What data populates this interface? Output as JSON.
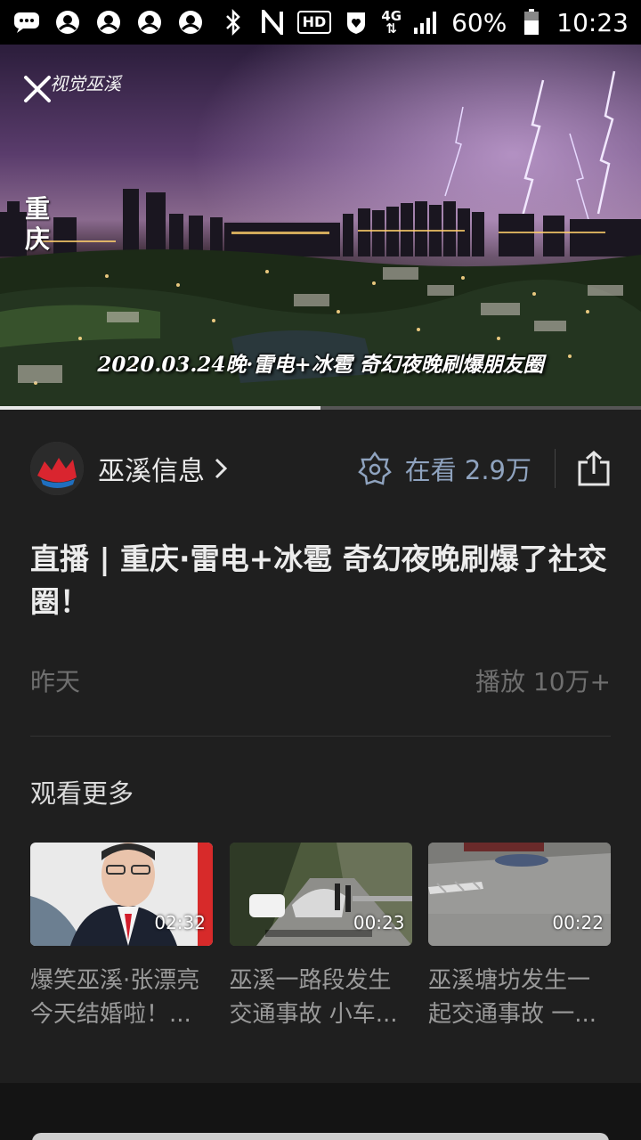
{
  "status_bar": {
    "battery": "60%",
    "time": "10:23",
    "hd": "HD",
    "network": "4G"
  },
  "video": {
    "watermark": "视觉巫溪",
    "city_label": "重庆",
    "caption": "2020.03.24晚·雷电+冰雹 奇幻夜晚刷爆朋友圈",
    "progress": 0.5
  },
  "author": {
    "name": "巫溪信息",
    "watching_label": "在看 2.9万"
  },
  "article": {
    "title": "直播 | 重庆·雷电+冰雹 奇幻夜晚刷爆了社交圈！",
    "date": "昨天",
    "plays": "播放 10万+"
  },
  "more": {
    "label": "观看更多",
    "items": [
      {
        "duration": "02:32",
        "title_line1": "爆笑巫溪·张漂亮",
        "title_line2": "今天结婚啦！..."
      },
      {
        "duration": "00:23",
        "title_line1": "巫溪一路段发生",
        "title_line2": "交通事故 小车..."
      },
      {
        "duration": "00:22",
        "title_line1": "巫溪塘坊发生一",
        "title_line2": "起交通事故 一..."
      }
    ]
  },
  "icons": {
    "close": "close-icon",
    "share": "share-icon",
    "watching": "watching-icon",
    "chevron": "chevron-right-icon"
  }
}
